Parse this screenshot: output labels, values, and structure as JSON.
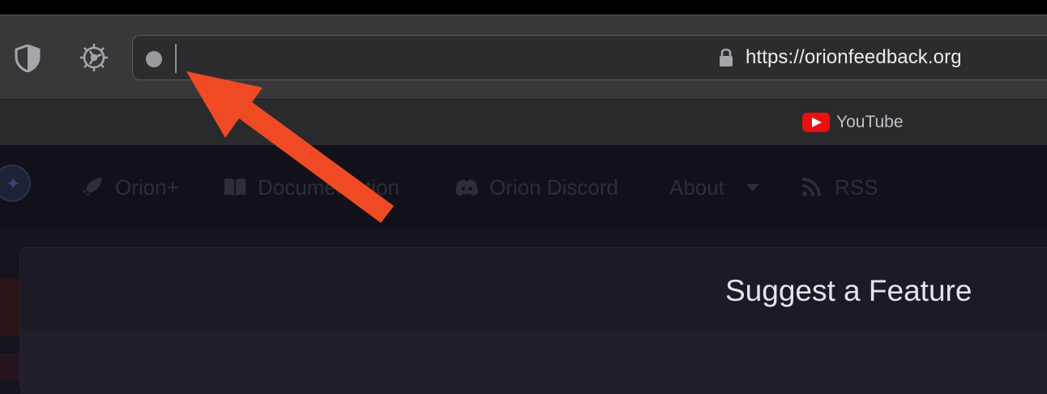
{
  "toolbar": {
    "shield_icon": "shield-icon",
    "gear_icon": "gear-icon",
    "url": "https://orionfeedback.org",
    "lock_icon": "lock-icon"
  },
  "favorites": [
    {
      "label": "YouTube",
      "icon": "youtube-icon"
    }
  ],
  "site_nav": {
    "items": [
      {
        "label": "Orion+",
        "icon": "rocket-icon"
      },
      {
        "label": "Documentation",
        "icon": "book-icon"
      },
      {
        "label": "Orion Discord",
        "icon": "discord-icon"
      },
      {
        "label": "About",
        "icon": "chevron-down-icon"
      },
      {
        "label": "RSS",
        "icon": "rss-icon"
      }
    ]
  },
  "panel": {
    "title": "Suggest a Feature"
  },
  "colors": {
    "toolbar_bg": "#38383a",
    "urlbar_bg": "#2c2c2e",
    "annotation_arrow": "#f04a25",
    "youtube_red": "#ee0f0f"
  }
}
